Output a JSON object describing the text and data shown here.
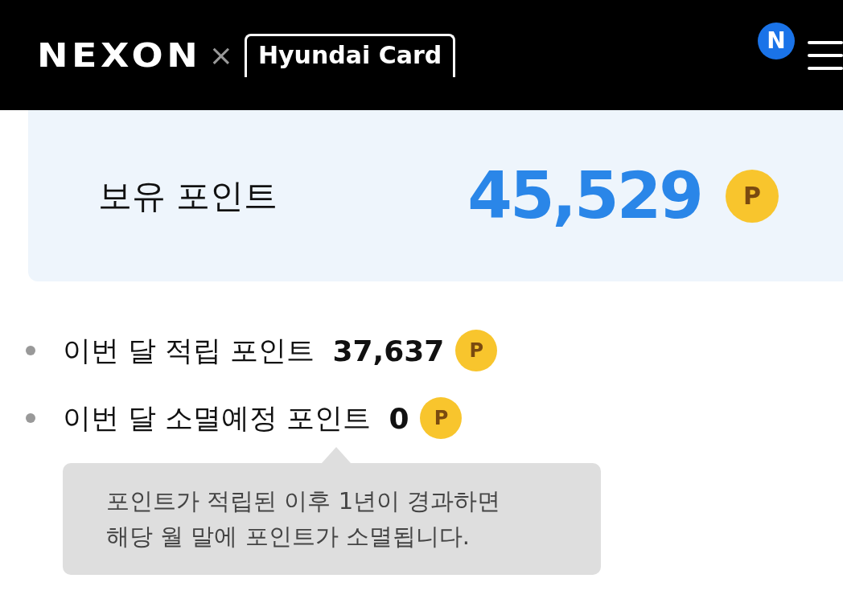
{
  "header": {
    "logo": "NEXON",
    "separator": "×",
    "partner_logo": "Hyundai Card",
    "avatar": "N"
  },
  "balance": {
    "label": "보유 포인트",
    "value": "45,529",
    "unit": "P"
  },
  "stats": [
    {
      "label": "이번 달 적립 포인트",
      "value": "37,637",
      "unit": "P"
    },
    {
      "label": "이번 달 소멸예정 포인트",
      "value": "0",
      "unit": "P"
    }
  ],
  "tooltip": {
    "lines": [
      "포인트가 적립된 이후 1년이 경과하면",
      "해당 월 말에 포인트가 소멸됩니다."
    ]
  }
}
